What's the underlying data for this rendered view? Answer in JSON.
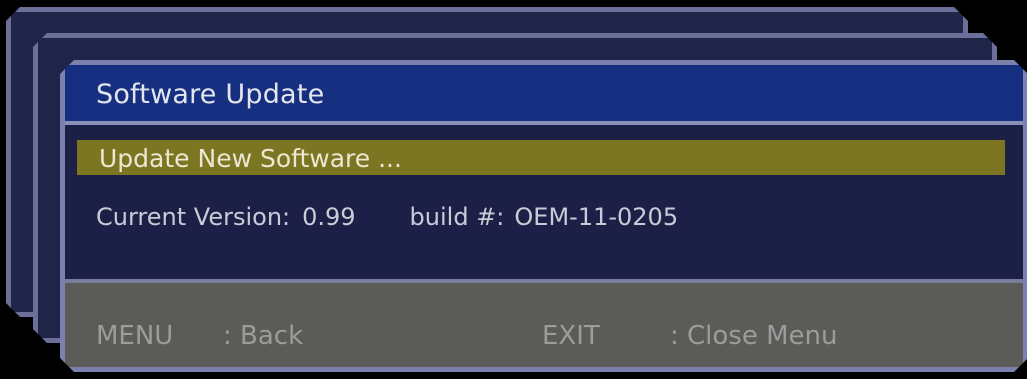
{
  "dialog": {
    "title": "Software Update",
    "selected_item": "Update New Software ...",
    "current_version_label": "Current Version:",
    "current_version_value": "0.99",
    "build_label": "build #:",
    "build_value": "OEM-11-0205"
  },
  "footer": {
    "menu_key": "MENU",
    "menu_action": ": Back",
    "exit_key": "EXIT",
    "exit_action": ": Close Menu"
  },
  "colors": {
    "title_bar": "#162f80",
    "highlight": "#7c7521",
    "panel_bg": "#1c2046",
    "footer_bg": "#5b5c58",
    "border": "#7b80ac"
  }
}
